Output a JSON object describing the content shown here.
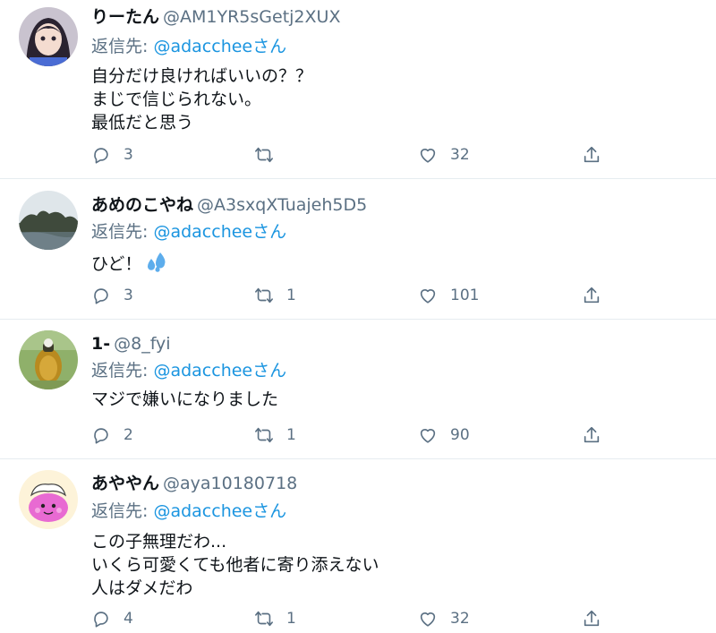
{
  "reply_prefix": "返信先: ",
  "tweets": [
    {
      "name": "りーたん",
      "handle": "@AM1YR5sGetj2XUX",
      "reply_mention": "@adaccheeさん",
      "lines": [
        "自分だけ良ければいいの？？",
        "まじで信じられない。",
        "最低だと思う"
      ],
      "replies": "3",
      "retweets": "",
      "likes": "32"
    },
    {
      "name": "あめのこやね",
      "handle": "@A3sxqXTuajeh5D5",
      "reply_mention": "@adaccheeさん",
      "lines": [
        "ひど！"
      ],
      "emoji": "sweat-droplets-icon",
      "replies": "3",
      "retweets": "1",
      "likes": "101"
    },
    {
      "name": "1-",
      "handle": "@8_fyi",
      "reply_mention": "@adaccheeさん",
      "lines": [
        "マジで嫌いになりました"
      ],
      "replies": "2",
      "retweets": "1",
      "likes": "90"
    },
    {
      "name": "あややん",
      "handle": "@aya10180718",
      "reply_mention": "@adaccheeさん",
      "lines": [
        "この子無理だわ...",
        "いくら可愛くても他者に寄り添えない",
        "人はダメだわ"
      ],
      "replies": "4",
      "retweets": "1",
      "likes": "32"
    }
  ],
  "icons": {
    "reply": "reply-bubble-icon",
    "retweet": "retweet-icon",
    "like": "heart-icon",
    "share": "share-upload-icon"
  },
  "colors": {
    "text": "#0f1419",
    "secondary": "#5b7083",
    "mention": "#1b95e0",
    "divider": "#e6ecf0"
  }
}
